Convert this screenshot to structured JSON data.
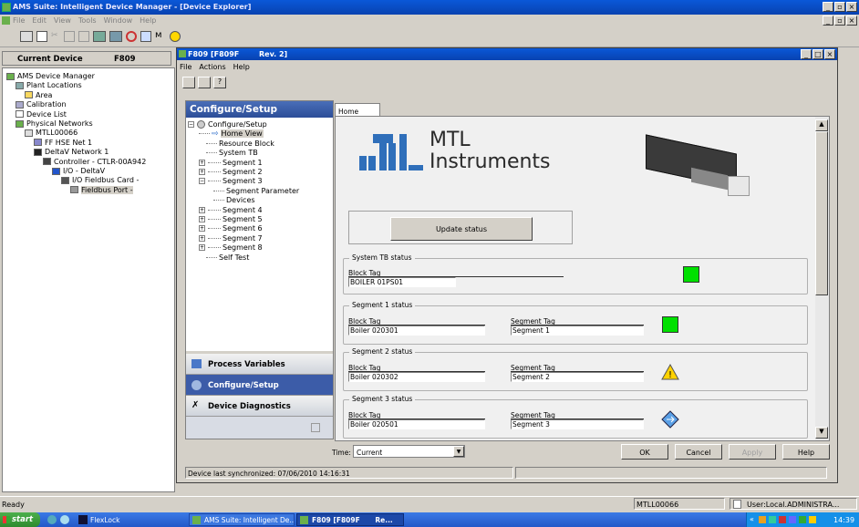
{
  "app": {
    "title": "AMS Suite: Intelligent Device Manager - [Device Explorer]",
    "menu": [
      "File",
      "Edit",
      "View",
      "Tools",
      "Window",
      "Help"
    ]
  },
  "left": {
    "current_device_label": "Current Device",
    "current_device_value": "F809",
    "tree": [
      {
        "label": "AMS Device Manager",
        "icon": "network-icon"
      },
      {
        "label": "Plant Locations",
        "icon": "plant-icon"
      },
      {
        "label": "Area",
        "icon": "folder-icon"
      },
      {
        "label": "Calibration",
        "icon": "calibration-icon"
      },
      {
        "label": "Device List",
        "icon": "list-icon"
      },
      {
        "label": "Physical Networks",
        "icon": "network-icon"
      },
      {
        "label": "MTLL00066",
        "icon": "computer-icon"
      },
      {
        "label": "FF HSE Net 1",
        "icon": "hse-icon"
      },
      {
        "label": "DeltaV Network 1",
        "icon": "deltav-icon"
      },
      {
        "label": "Controller - CTLR-00A942",
        "icon": "controller-icon"
      },
      {
        "label": "I/O - DeltaV",
        "icon": "io-icon"
      },
      {
        "label": "I/O Fieldbus Card -",
        "icon": "card-icon"
      },
      {
        "label": "Fieldbus Port -",
        "icon": "port-icon"
      }
    ]
  },
  "child": {
    "title": "F809 [F809F",
    "rev": "Rev. 2]",
    "menu": [
      "File",
      "Actions",
      "Help"
    ]
  },
  "nav": {
    "header": "Configure/Setup",
    "tree": [
      {
        "label": "Configure/Setup"
      },
      {
        "label": "Home View"
      },
      {
        "label": "Resource Block"
      },
      {
        "label": "System TB"
      },
      {
        "label": "Segment 1"
      },
      {
        "label": "Segment 2"
      },
      {
        "label": "Segment 3"
      },
      {
        "label": "Segment Parameter"
      },
      {
        "label": "Devices"
      },
      {
        "label": "Segment 4"
      },
      {
        "label": "Segment 5"
      },
      {
        "label": "Segment 6"
      },
      {
        "label": "Segment 7"
      },
      {
        "label": "Segment 8"
      },
      {
        "label": "Self Test"
      }
    ],
    "buttons": [
      "Process Variables",
      "Configure/Setup",
      "Device Diagnostics"
    ]
  },
  "main": {
    "tab": "Home View",
    "brand_line1": "MTL",
    "brand_line2": "Instruments",
    "update_btn": "Update status",
    "sys": {
      "title": "System TB status",
      "block_tag_label": "Block Tag",
      "block_tag": "BOILER 01PS01",
      "status_color": "#00e000"
    },
    "seg1": {
      "title": "Segment 1 status",
      "block_tag_label": "Block Tag",
      "block_tag": "Boiler 020301",
      "segment_tag_label": "Segment Tag",
      "segment_tag": "Segment 1",
      "status_color": "#00e000"
    },
    "seg2": {
      "title": "Segment 2 status",
      "block_tag_label": "Block Tag",
      "block_tag": "Boiler 020302",
      "segment_tag_label": "Segment Tag",
      "segment_tag": "Segment 2",
      "status_icon": "warning-icon"
    },
    "seg3": {
      "title": "Segment 3 status",
      "block_tag_label": "Block Tag",
      "block_tag": "Boiler 020501",
      "segment_tag_label": "Segment Tag",
      "segment_tag": "Segment 3",
      "status_icon": "diamond-icon"
    }
  },
  "bottom": {
    "time_label": "Time:",
    "time_value": "Current",
    "ok": "OK",
    "cancel": "Cancel",
    "apply": "Apply",
    "help": "Help",
    "sync": "Device last synchronized: 07/06/2010 14:16:31"
  },
  "status": {
    "ready": "Ready",
    "machine": "MTLL00066",
    "user": "User:Local.ADMINISTRA..."
  },
  "taskbar": {
    "start": "start",
    "items": [
      "FlexLock",
      "AMS Suite: Intelligent De...",
      "F809 [F809F",
      "Re..."
    ],
    "clock": "14:39"
  }
}
